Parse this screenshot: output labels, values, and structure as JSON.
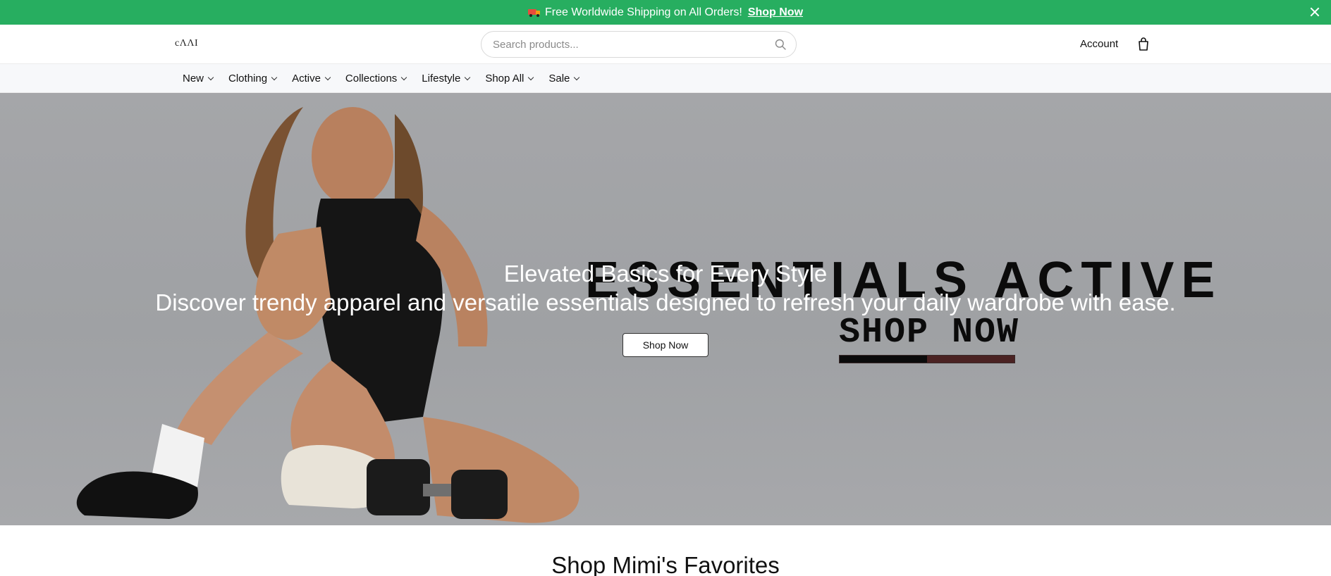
{
  "announcement": {
    "icon": "delivery-truck-icon",
    "message": "Free Worldwide Shipping on All Orders!",
    "cta": "Shop Now"
  },
  "header": {
    "logo_text": "cΛΛI",
    "search_placeholder": "Search products...",
    "account_label": "Account",
    "bag_icon": "shopping-bag-icon"
  },
  "nav": {
    "items": [
      {
        "label": "New"
      },
      {
        "label": "Clothing"
      },
      {
        "label": "Active"
      },
      {
        "label": "Collections"
      },
      {
        "label": "Lifestyle"
      },
      {
        "label": "Shop All"
      },
      {
        "label": "Sale"
      }
    ]
  },
  "hero": {
    "promo_headline": "ESSENTIALS ACTIVE",
    "promo_cta": "SHOP NOW",
    "title": "Elevated Basics for Every Style",
    "subtitle": "Discover trendy apparel and versatile essentials designed to refresh your daily wardrobe with ease.",
    "button": "Shop Now"
  },
  "section": {
    "title": "Shop Mimi's Favorites"
  },
  "colors": {
    "announcement_bg": "#27ae60",
    "nav_bg": "#f7f8fa",
    "hero_bg": "#a3a4a7"
  }
}
